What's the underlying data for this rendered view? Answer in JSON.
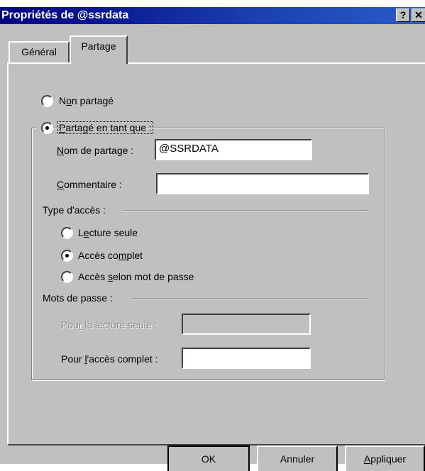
{
  "window": {
    "title": "Propriétés de @ssrdata",
    "help_button": "?",
    "close_button": "✕"
  },
  "tabs": [
    {
      "label": "Général",
      "active": false
    },
    {
      "label": "Partage",
      "active": true
    }
  ],
  "sharing": {
    "not_shared_label": "Non partagé",
    "shared_as_label": "Partagé en tant que :",
    "selected": "shared_as",
    "share_name_label": "Nom de partage :",
    "share_name_value": "@SSRDATA",
    "comment_label": "Commentaire :",
    "comment_value": ""
  },
  "access_type": {
    "heading": "Type d'accès :",
    "options": [
      {
        "label": "Lecture seule",
        "checked": false
      },
      {
        "label": "Accès complet",
        "checked": true
      },
      {
        "label": "Accès selon mot de passe",
        "checked": false
      }
    ]
  },
  "passwords": {
    "heading": "Mots de passe :",
    "readonly_label": "Pour la lecture seule :",
    "readonly_value": "",
    "readonly_enabled": false,
    "full_label": "Pour l'accès complet :",
    "full_value": ""
  },
  "buttons": {
    "ok": "OK",
    "cancel": "Annuler",
    "apply": "Appliquer"
  }
}
